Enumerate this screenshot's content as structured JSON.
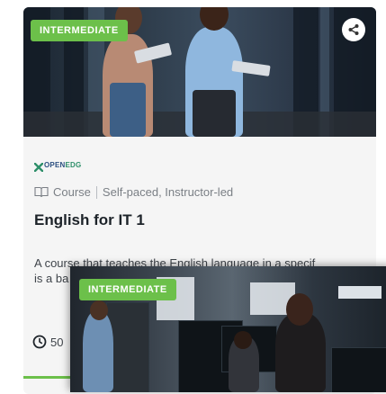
{
  "card": {
    "level_badge": "INTERMEDIATE",
    "share_icon": "share-icon",
    "provider": {
      "part1": "OPEN",
      "part2": "EDG"
    },
    "type": "Course",
    "delivery": "Self-paced, Instructor-led",
    "title": "English for IT 1",
    "description": "A course that teaches the English language in a specif",
    "description_line3": "is a ba",
    "duration": "50",
    "duration_icon": "clock-icon",
    "type_icon": "book-icon",
    "accent_color": "#6cc04a"
  },
  "card2": {
    "level_badge": "INTERMEDIATE"
  }
}
